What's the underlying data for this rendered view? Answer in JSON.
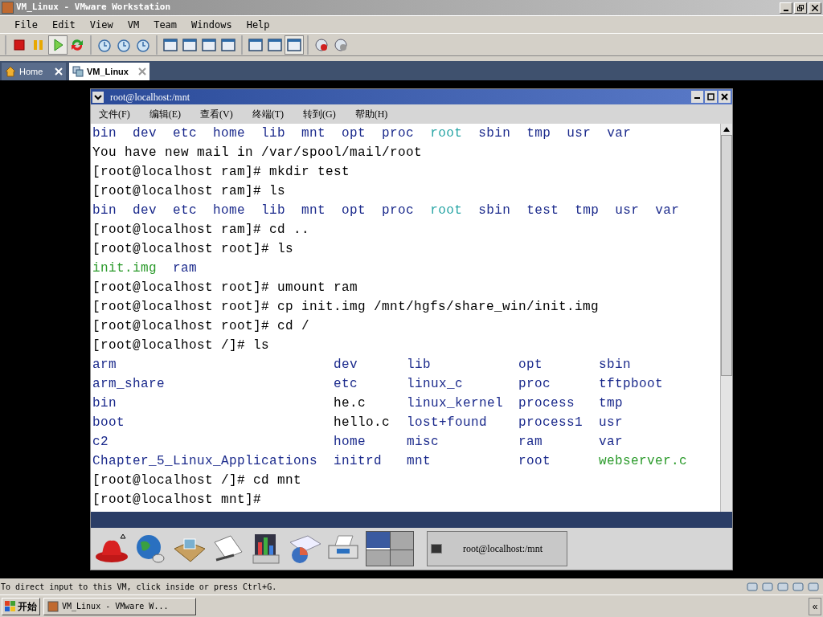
{
  "window": {
    "title": "VM_Linux - VMware Workstation"
  },
  "menu": [
    "File",
    "Edit",
    "View",
    "VM",
    "Team",
    "Windows",
    "Help"
  ],
  "toolbar": [
    [
      {
        "kind": "stop",
        "pressed": false
      },
      {
        "kind": "pause",
        "pressed": false
      },
      {
        "kind": "play",
        "pressed": true
      },
      {
        "kind": "reset",
        "pressed": false
      }
    ],
    [
      {
        "kind": "snapshot",
        "pressed": false
      },
      {
        "kind": "revert",
        "pressed": false
      },
      {
        "kind": "manager",
        "pressed": false
      }
    ],
    [
      {
        "kind": "sidebar",
        "pressed": false
      },
      {
        "kind": "fullscreen",
        "pressed": false
      },
      {
        "kind": "fit",
        "pressed": false
      },
      {
        "kind": "unity",
        "pressed": false
      }
    ],
    [
      {
        "kind": "console",
        "pressed": false
      },
      {
        "kind": "summary",
        "pressed": false
      },
      {
        "kind": "switch",
        "pressed": true
      }
    ],
    [
      {
        "kind": "record",
        "pressed": false
      },
      {
        "kind": "replay",
        "pressed": false
      }
    ]
  ],
  "tabs": [
    {
      "label": "Home",
      "kind": "home",
      "selected": false
    },
    {
      "label": "VM_Linux",
      "kind": "vm",
      "selected": true
    }
  ],
  "guest": {
    "title": "root@localhost:/mnt",
    "menu": [
      "文件(F)",
      "编辑(E)",
      "查看(V)",
      "终端(T)",
      "转到(G)",
      "帮助(H)"
    ],
    "terminal": [
      {
        "kind": "listing",
        "items": [
          {
            "name": "bin",
            "color": "#1b2a8c"
          },
          {
            "name": "dev",
            "color": "#1b2a8c"
          },
          {
            "name": "etc",
            "color": "#1b2a8c"
          },
          {
            "name": "home",
            "color": "#1b2a8c"
          },
          {
            "name": "lib",
            "color": "#1b2a8c"
          },
          {
            "name": "mnt",
            "color": "#1b2a8c"
          },
          {
            "name": "opt",
            "color": "#1b2a8c"
          },
          {
            "name": "proc",
            "color": "#1b2a8c"
          },
          {
            "name": "root",
            "color": "#2aa6a6"
          },
          {
            "name": "sbin",
            "color": "#1b2a8c"
          },
          {
            "name": "tmp",
            "color": "#1b2a8c"
          },
          {
            "name": "usr",
            "color": "#1b2a8c"
          },
          {
            "name": "var",
            "color": "#1b2a8c"
          }
        ]
      },
      {
        "kind": "text",
        "text": "You have new mail in /var/spool/mail/root"
      },
      {
        "kind": "text",
        "text": "[root@localhost ram]# mkdir test"
      },
      {
        "kind": "text",
        "text": "[root@localhost ram]# ls"
      },
      {
        "kind": "listing",
        "items": [
          {
            "name": "bin",
            "color": "#1b2a8c"
          },
          {
            "name": "dev",
            "color": "#1b2a8c"
          },
          {
            "name": "etc",
            "color": "#1b2a8c"
          },
          {
            "name": "home",
            "color": "#1b2a8c"
          },
          {
            "name": "lib",
            "color": "#1b2a8c"
          },
          {
            "name": "mnt",
            "color": "#1b2a8c"
          },
          {
            "name": "opt",
            "color": "#1b2a8c"
          },
          {
            "name": "proc",
            "color": "#1b2a8c"
          },
          {
            "name": "root",
            "color": "#2aa6a6"
          },
          {
            "name": "sbin",
            "color": "#1b2a8c"
          },
          {
            "name": "test",
            "color": "#1b2a8c"
          },
          {
            "name": "tmp",
            "color": "#1b2a8c"
          },
          {
            "name": "usr",
            "color": "#1b2a8c"
          },
          {
            "name": "var",
            "color": "#1b2a8c"
          }
        ]
      },
      {
        "kind": "text",
        "text": "[root@localhost ram]# cd .."
      },
      {
        "kind": "text",
        "text": "[root@localhost root]# ls"
      },
      {
        "kind": "listing",
        "items": [
          {
            "name": "init.img",
            "color": "#2a9a2a"
          },
          {
            "name": "ram",
            "color": "#1b2a8c"
          }
        ]
      },
      {
        "kind": "text",
        "text": "[root@localhost root]# umount ram"
      },
      {
        "kind": "text",
        "text": "[root@localhost root]# cp init.img /mnt/hgfs/share_win/init.img"
      },
      {
        "kind": "text",
        "text": "[root@localhost root]# cd /"
      },
      {
        "kind": "text",
        "text": "[root@localhost /]# ls"
      },
      {
        "kind": "columns",
        "rows": [
          [
            {
              "name": "arm",
              "color": "#1b2a8c"
            },
            {
              "name": "dev",
              "color": "#1b2a8c"
            },
            {
              "name": "lib",
              "color": "#1b2a8c"
            },
            {
              "name": "opt",
              "color": "#1b2a8c"
            },
            {
              "name": "sbin",
              "color": "#1b2a8c"
            }
          ],
          [
            {
              "name": "arm_share",
              "color": "#1b2a8c"
            },
            {
              "name": "etc",
              "color": "#1b2a8c"
            },
            {
              "name": "linux_c",
              "color": "#1b2a8c"
            },
            {
              "name": "proc",
              "color": "#1b2a8c"
            },
            {
              "name": "tftpboot",
              "color": "#1b2a8c"
            }
          ],
          [
            {
              "name": "bin",
              "color": "#1b2a8c"
            },
            {
              "name": "he.c",
              "color": "#000000"
            },
            {
              "name": "linux_kernel",
              "color": "#1b2a8c"
            },
            {
              "name": "process",
              "color": "#1b2a8c"
            },
            {
              "name": "tmp",
              "color": "#1b2a8c"
            }
          ],
          [
            {
              "name": "boot",
              "color": "#1b2a8c"
            },
            {
              "name": "hello.c",
              "color": "#000000"
            },
            {
              "name": "lost+found",
              "color": "#1b2a8c"
            },
            {
              "name": "process1",
              "color": "#1b2a8c"
            },
            {
              "name": "usr",
              "color": "#1b2a8c"
            }
          ],
          [
            {
              "name": "c2",
              "color": "#1b2a8c"
            },
            {
              "name": "home",
              "color": "#1b2a8c"
            },
            {
              "name": "misc",
              "color": "#1b2a8c"
            },
            {
              "name": "ram",
              "color": "#1b2a8c"
            },
            {
              "name": "var",
              "color": "#1b2a8c"
            }
          ],
          [
            {
              "name": "Chapter_5_Linux_Applications",
              "color": "#1b2a8c"
            },
            {
              "name": "initrd",
              "color": "#1b2a8c"
            },
            {
              "name": "mnt",
              "color": "#1b2a8c"
            },
            {
              "name": "root",
              "color": "#1b2a8c"
            },
            {
              "name": "webserver.c",
              "color": "#2a9a2a"
            }
          ]
        ]
      },
      {
        "kind": "text",
        "text": "[root@localhost /]# cd mnt"
      },
      {
        "kind": "text",
        "text": "[root@localhost mnt]#"
      }
    ],
    "panel": {
      "workspaces": [
        {
          "selected": true
        },
        {
          "selected": false
        },
        {
          "selected": false
        },
        {
          "selected": false
        }
      ],
      "task": "root@localhost:/mnt"
    }
  },
  "status_bar": {
    "text": "To direct input to this VM, click inside or press Ctrl+G."
  },
  "taskbar": {
    "start": "开始",
    "task": "VM_Linux - VMware W...",
    "collapse": "«"
  }
}
